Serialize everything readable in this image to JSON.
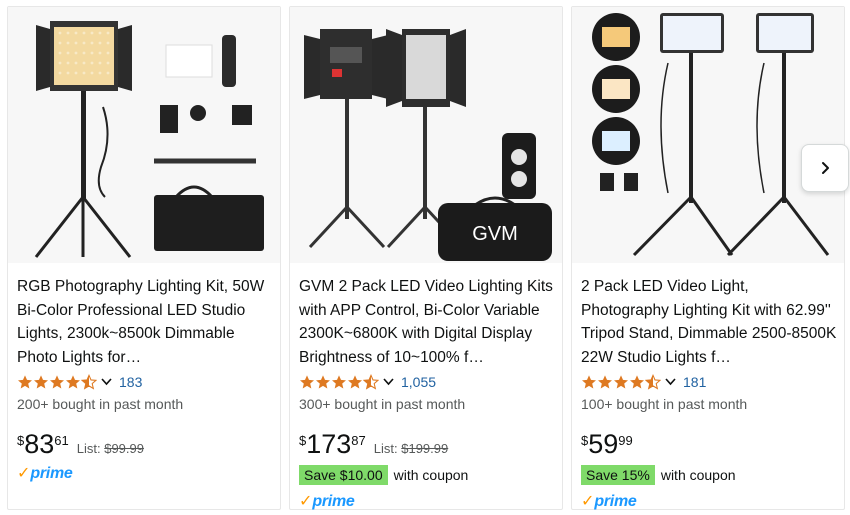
{
  "products": [
    {
      "title": "RGB Photography Lighting Kit, 50W Bi-Color Professional LED Studio Lights, 2300k~8500k Dimmable Photo Lights for…",
      "rating": 4.5,
      "reviews": "183",
      "bought": "200+ bought in past month",
      "price_symbol": "$",
      "price_whole": "83",
      "price_fraction": "61",
      "list_label": "List:",
      "list_price": "$99.99",
      "prime": "prime"
    },
    {
      "title": "GVM 2 Pack LED Video Lighting Kits with APP Control, Bi-Color Variable 2300K~6800K with Digital Display Brightness of 10~100% f…",
      "rating": 4.5,
      "reviews": "1,055",
      "bought": "300+ bought in past month",
      "price_symbol": "$",
      "price_whole": "173",
      "price_fraction": "87",
      "list_label": "List:",
      "list_price": "$199.99",
      "coupon_badge": "Save $10.00",
      "coupon_text": "with coupon",
      "prime": "prime",
      "brand_mark": "GVM"
    },
    {
      "title": "2 Pack LED Video Light, Photography Lighting Kit with 62.99'' Tripod Stand, Dimmable 2500-8500K 22W Studio Lights f…",
      "rating": 4.5,
      "reviews": "181",
      "bought": "100+ bought in past month",
      "price_symbol": "$",
      "price_whole": "59",
      "price_fraction": "99",
      "coupon_badge": "Save 15%",
      "coupon_text": "with coupon",
      "prime": "prime"
    }
  ],
  "colors": {
    "star": "#de7921",
    "link": "#2162a1",
    "coupon_badge": "#7fda69",
    "prime_check": "#ff9900",
    "prime_word": "#1a98ff"
  },
  "icons": {
    "next": "chevron-right-icon",
    "rating_popover": "chevron-down-icon",
    "star": "star-icon"
  }
}
